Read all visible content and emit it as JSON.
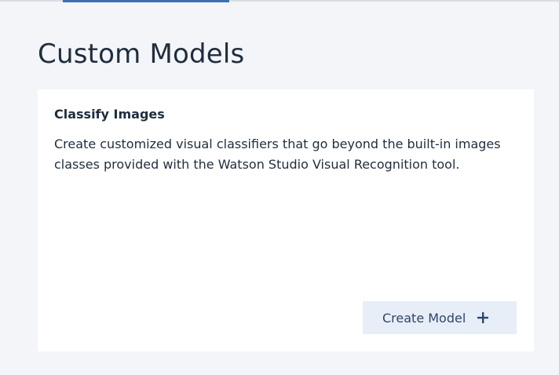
{
  "header": {
    "active_tab_indicator": "active-tab-underline"
  },
  "main": {
    "title": "Custom Models"
  },
  "card": {
    "title": "Classify Images",
    "description": "Create customized visual classifiers that go beyond the built-in images classes provided with the Watson Studio Visual Recognition tool.",
    "button_label": "Create Model",
    "button_icon": "plus-icon"
  },
  "colors": {
    "background": "#f3f5f9",
    "card_background": "#ffffff",
    "accent": "#3d70b2",
    "button_background": "#e8eef7",
    "button_text": "#2d4669",
    "text": "#1f2d3d"
  }
}
